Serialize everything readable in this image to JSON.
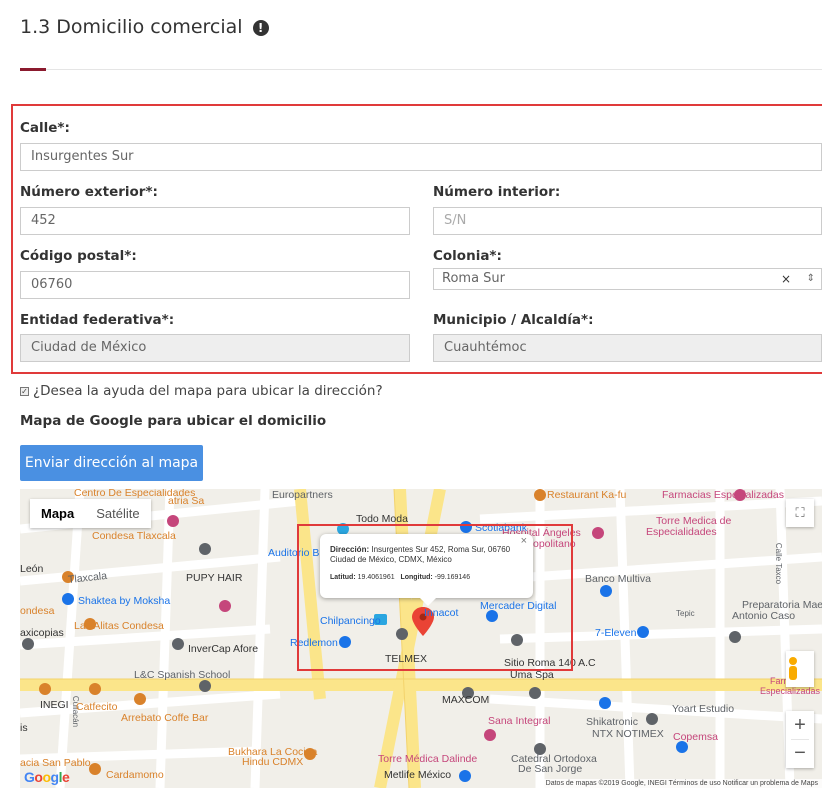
{
  "section": {
    "title": "1.3 Domicilio comercial",
    "info_icon": "exclamation-circle-icon"
  },
  "form": {
    "calle": {
      "label": "Calle*:",
      "value": "Insurgentes Sur"
    },
    "numero_exterior": {
      "label": "Número exterior*:",
      "value": "452"
    },
    "numero_interior": {
      "label": "Número interior:",
      "placeholder": "S/N"
    },
    "codigo_postal": {
      "label": "Código postal*:",
      "value": "06760"
    },
    "colonia": {
      "label": "Colonia*:",
      "value": "Roma Sur",
      "clear": "×",
      "arrow": "⇕"
    },
    "entidad": {
      "label": "Entidad federativa*:",
      "value": "Ciudad de México"
    },
    "municipio": {
      "label": "Municipio / Alcaldía*:",
      "value": "Cuauhtémoc"
    }
  },
  "map_help": {
    "checkbox_label": "¿Desea la ayuda del mapa para ubicar la dirección?",
    "checked": true
  },
  "map_heading": "Mapa de Google para ubicar el domicilio",
  "send_button": "Enviar dirección al mapa",
  "map": {
    "type_buttons": [
      "Mapa",
      "Satélite"
    ],
    "active_type": "Mapa",
    "zoom_in": "+",
    "zoom_out": "−",
    "fullscreen_icon": "fullscreen-icon",
    "pegman_icon": "pegman-icon",
    "popup": {
      "address_label": "Dirección:",
      "address": "Insurgentes Sur 452, Roma Sur, 06760 Ciudad de México, CDMX, México",
      "lat_label": "Latitud:",
      "lat": "19.4061961",
      "lng_label": "Longitud:",
      "lng": "-99.169146",
      "close": "×"
    },
    "labels": [
      "Centro De Especialidades",
      "atria Sa",
      "Europartners",
      "Restaurant Ka-fu",
      "Farmacias Especializadas",
      "Condesa Tlaxcala",
      "Todo Moda",
      "Scotiabank",
      "Hospital Ángeles",
      "Metropolitano",
      "Torre Medica de",
      "Especialidades",
      "Calle Taxco",
      "Auditorio B",
      "León",
      "Tlaxcala",
      "PUPY HAIR",
      "Banco Multiva",
      "Shaktea by Moksha",
      "ondesa",
      "Innacot",
      "Mercader Digital",
      "Tepic",
      "Preparatoria Maest",
      "Antonio Caso",
      "Las Alitas Condesa",
      "axicopias",
      "Chilpancingo",
      "7-Eleven",
      "InverCap Afore",
      "Redlemon",
      "TELMEX",
      "Sitio Roma 140 A.C",
      "L&C Spanish School",
      "Uma Spa",
      "Farmacias",
      "Especializadas",
      "INEGI",
      "Culiacán",
      "Catfecito",
      "Arrebato Coffe Bar",
      "MAXCOM",
      "Sana Integral",
      "Shikatronic",
      "NTX NOTIMEX",
      "Yoart Estudio",
      "Copemsa",
      "Torre Médica Dalinde",
      "Catedral Ortodoxa",
      "De San Jorge",
      "Bukhara La Cocina",
      "Hindu CDMX",
      "acia San Pablo",
      "Cardamomo",
      "Metlife México",
      "is"
    ],
    "footer": "Datos de mapas ©2019 Google, INEGI   Términos de uso   Notificar un problema de Maps",
    "google_logo": "Google",
    "colors": {
      "road_yellow": "#fbe58a",
      "road_white": "#ffffff",
      "metro": "#2ba6e0",
      "pin": "#ea4335"
    }
  }
}
